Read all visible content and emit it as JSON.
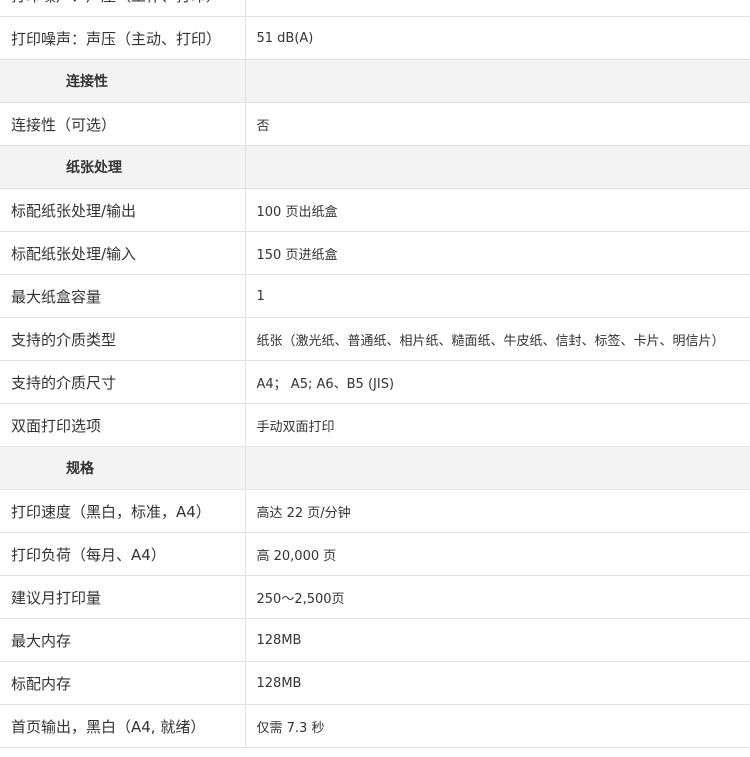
{
  "rows": [
    {
      "type": "spec",
      "label": "打印噪声：声压（工作、打印）",
      "value": ""
    },
    {
      "type": "spec",
      "label": "打印噪声：声压（主动、打印）",
      "value": "51 dB(A)"
    },
    {
      "type": "section",
      "label": "连接性"
    },
    {
      "type": "spec",
      "label": "连接性（可选）",
      "value": "否"
    },
    {
      "type": "section",
      "label": "纸张处理"
    },
    {
      "type": "spec",
      "label": "标配纸张处理/输出",
      "value": "100 页出纸盒"
    },
    {
      "type": "spec",
      "label": "标配纸张处理/输入",
      "value": "150 页进纸盒"
    },
    {
      "type": "spec",
      "label": "最大纸盒容量",
      "value": "1"
    },
    {
      "type": "spec",
      "label": "支持的介质类型",
      "value": "纸张（激光纸、普通纸、相片纸、糙面纸、牛皮纸、信封、标签、卡片、明信片）"
    },
    {
      "type": "spec",
      "label": "支持的介质尺寸",
      "value": "A4； A5; A6、B5 (JIS)"
    },
    {
      "type": "spec",
      "label": "双面打印选项",
      "value": "手动双面打印"
    },
    {
      "type": "section",
      "label": "规格"
    },
    {
      "type": "spec",
      "label": "打印速度（黑白，标准，A4）",
      "value": "高达 22 页/分钟"
    },
    {
      "type": "spec",
      "label": "打印负荷（每月、A4）",
      "value": "高 20,000 页"
    },
    {
      "type": "spec",
      "label": "建议月打印量",
      "value": "250～2,500页"
    },
    {
      "type": "spec",
      "label": "最大内存",
      "value": "128MB"
    },
    {
      "type": "spec",
      "label": "标配内存",
      "value": "128MB"
    },
    {
      "type": "spec",
      "label": "首页输出，黑白（A4, 就绪）",
      "value": "仅需 7.3 秒"
    }
  ]
}
